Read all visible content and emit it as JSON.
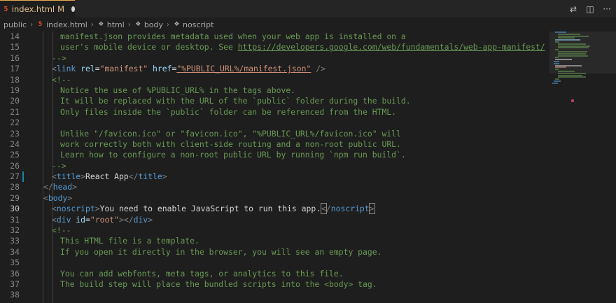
{
  "tab": {
    "icon": "html5-icon",
    "name": "index.html",
    "status": "M"
  },
  "actions": [
    {
      "icon": "open-changes-icon",
      "glyph": "⇄"
    },
    {
      "icon": "split-editor-icon",
      "glyph": "◫"
    },
    {
      "icon": "more-actions-icon",
      "glyph": "···"
    }
  ],
  "breadcrumb": [
    "public",
    "index.html",
    "html",
    "body",
    "noscript"
  ],
  "editor": {
    "active_line": "30",
    "line_numbers": [
      "14",
      "15",
      "16",
      "17",
      "18",
      "19",
      "20",
      "21",
      "22",
      "23",
      "24",
      "25",
      "26",
      "27",
      "28",
      "29",
      "30",
      "31",
      "32",
      "33",
      "34",
      "35",
      "36",
      "37",
      "38"
    ],
    "lines": [
      "manifest.json provides metadata used when your web app is installed on a",
      "user's mobile device or desktop. See ",
      "-->",
      "",
      "<!--",
      "Notice the use of %PUBLIC_URL% in the tags above.",
      "It will be replaced with the URL of the `public` folder during the build.",
      "Only files inside the `public` folder can be referenced from the HTML.",
      "",
      "Unlike \"/favicon.ico\" or \"favicon.ico\", \"%PUBLIC_URL%/favicon.ico\" will",
      "work correctly both with client-side routing and a non-root public URL.",
      "Learn how to configure a non-root public URL by running `npm run build`.",
      "-->",
      "",
      "",
      "",
      "",
      "",
      "<!--",
      "This HTML file is a template.",
      "If you open it directly in the browser, you will see an empty page.",
      "",
      "You can add webfonts, meta tags, or analytics to this file.",
      "The build step will place the bundled scripts into the <body> tag.",
      ""
    ],
    "link_url": "https://developers.google.com/web/fundamentals/web-app-manifest/",
    "link_tag": {
      "rel_value": "\"manifest\"",
      "href_value": "\"%PUBLIC_URL%/manifest.json\""
    },
    "title_text": "React App",
    "noscript_text": "You need to enable JavaScript to run this app.",
    "div_id_value": "\"root\""
  },
  "colors": {
    "comment": "#6a9955",
    "tag": "#569cd6",
    "attr": "#9cdcfe",
    "string": "#ce9178",
    "modified": "#e2c08d"
  }
}
